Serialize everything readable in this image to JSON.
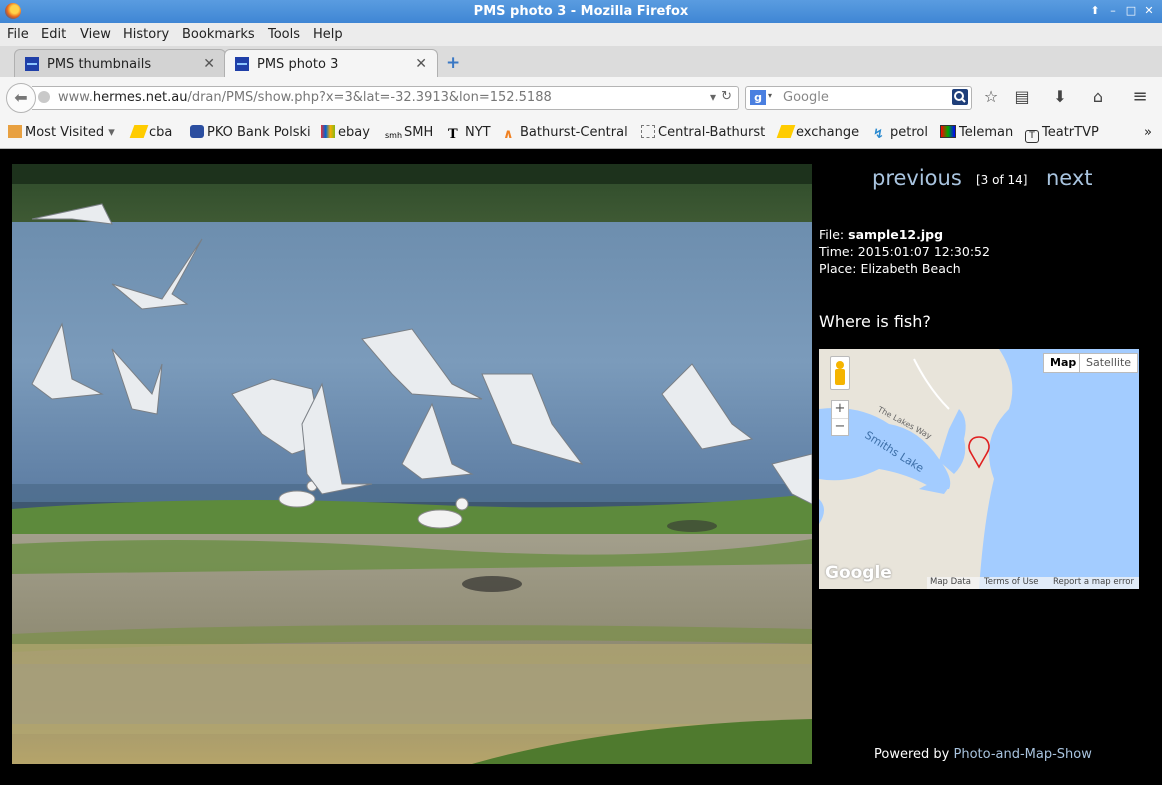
{
  "window": {
    "title": "PMS photo 3 - Mozilla Firefox"
  },
  "menu": {
    "items": [
      "File",
      "Edit",
      "View",
      "History",
      "Bookmarks",
      "Tools",
      "Help"
    ]
  },
  "tabs": [
    {
      "label": "PMS thumbnails",
      "active": false
    },
    {
      "label": "PMS photo 3",
      "active": true
    }
  ],
  "urlbar": {
    "prefix": "www.",
    "host": "hermes.net.au",
    "path": "/dran/PMS/show.php?x=3&lat=-32.3913&lon=152.5188"
  },
  "search": {
    "placeholder": "Google"
  },
  "bookmarks": [
    "Most Visited",
    "cba",
    "PKO Bank Polski",
    "ebay",
    "SMH",
    "NYT",
    "Bathurst-Central",
    "Central-Bathurst",
    "exchange",
    "petrol",
    "Teleman",
    "TeatrTVP"
  ],
  "bookmarks_overflow": "»",
  "page": {
    "previous": "previous",
    "next": "next",
    "counter": "[3 of 14]",
    "file_label": "File:",
    "file": "sample12.jpg",
    "time_label": "Time:",
    "time": "2015:01:07 12:30:52",
    "place_label": "Place:",
    "place": "Elizabeth Beach",
    "caption": "Where is fish?",
    "powered_by": "Powered by",
    "powered_link": "Photo-and-Map-Show"
  },
  "map": {
    "type_map": "Map",
    "type_satellite": "Satellite",
    "label_lake": "Smiths Lake",
    "label_road": "The Lakes Way",
    "zoom_in": "+",
    "zoom_out": "−",
    "logo": "Google",
    "footer": [
      "Map Data",
      "Terms of Use",
      "Report a map error"
    ],
    "water_color": "#a3ccff",
    "land_color": "#e8e4da",
    "marker_color": "#e02020"
  }
}
